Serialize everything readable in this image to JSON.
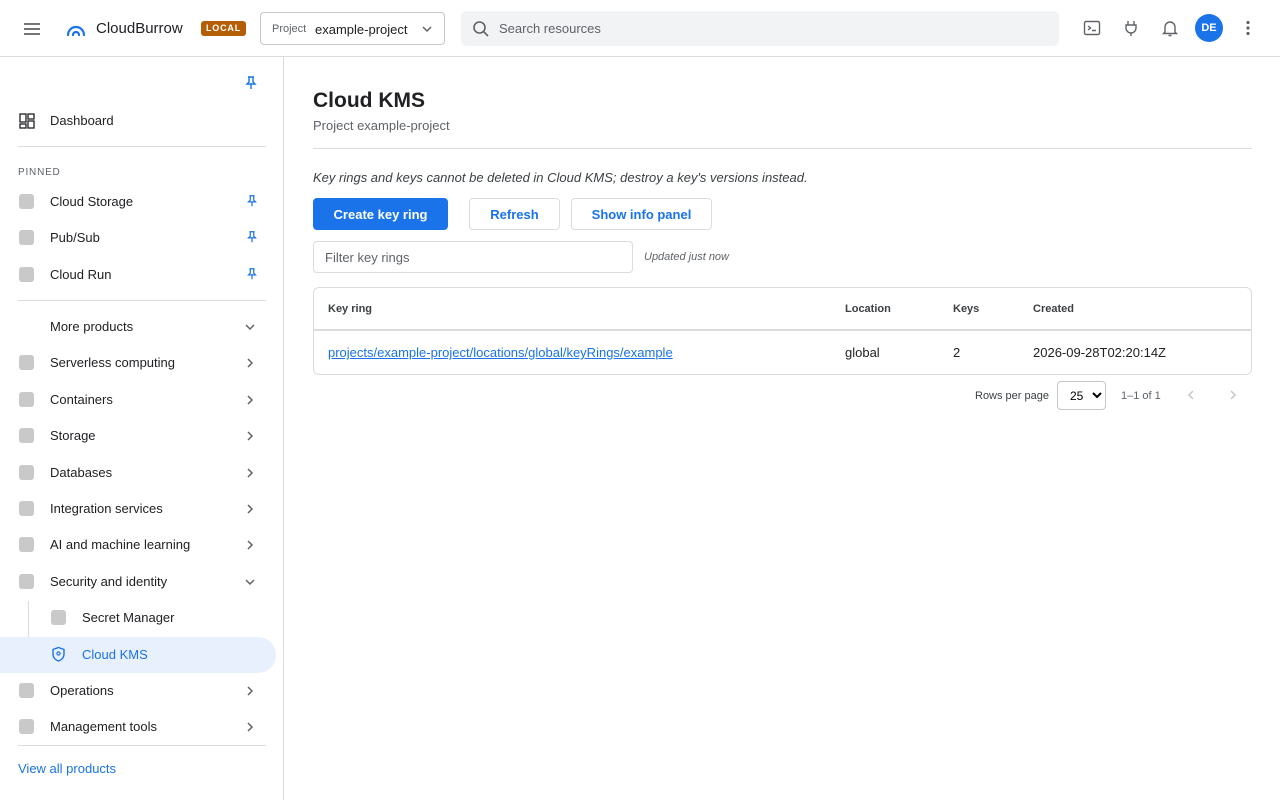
{
  "topbar": {
    "brand": "CloudBurrow",
    "badge": "LOCAL",
    "project_label": "Project",
    "project_value": "example-project",
    "search_placeholder": "Search resources",
    "avatar_initials": "DE"
  },
  "sidebar": {
    "dashboard_label": "Dashboard",
    "pinned_heading": "PINNED",
    "pinned": [
      {
        "label": "Cloud Storage"
      },
      {
        "label": "Pub/Sub"
      },
      {
        "label": "Cloud Run"
      }
    ],
    "more_products_label": "More products",
    "categories": [
      {
        "label": "Serverless computing"
      },
      {
        "label": "Containers"
      },
      {
        "label": "Storage"
      },
      {
        "label": "Databases"
      },
      {
        "label": "Integration services"
      },
      {
        "label": "AI and machine learning"
      },
      {
        "label": "Security and identity"
      }
    ],
    "security_children": [
      {
        "label": "Secret Manager"
      },
      {
        "label": "Cloud KMS"
      }
    ],
    "after": [
      {
        "label": "Operations"
      },
      {
        "label": "Management tools"
      }
    ],
    "view_all_label": "View all products"
  },
  "main": {
    "title": "Cloud KMS",
    "subtitle": "Project example-project",
    "note": "Key rings and keys cannot be deleted in Cloud KMS; destroy a key's versions instead.",
    "create_button": "Create key ring",
    "refresh_button": "Refresh",
    "info_button": "Show info panel",
    "filter_placeholder": "Filter key rings",
    "updated_text": "Updated just now",
    "table": {
      "headers": [
        "Key ring",
        "Location",
        "Keys",
        "Created"
      ],
      "rows": [
        {
          "key_ring": "projects/example-project/locations/global/keyRings/example",
          "location": "global",
          "keys": "2",
          "created": "2026-09-28T02:20:14Z"
        }
      ]
    },
    "pager": {
      "rows_per_page_label": "Rows per page",
      "rows_per_page_value": "25",
      "count_text": "1–1 of 1"
    }
  },
  "colors": {
    "accent": "#1a73e8",
    "badge": "#b45f06",
    "active_bg": "#e8f0fe"
  }
}
